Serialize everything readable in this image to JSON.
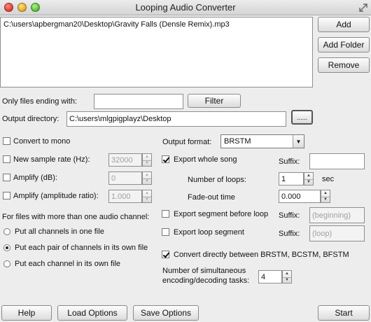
{
  "window": {
    "title": "Looping Audio Converter"
  },
  "file_list": {
    "items": [
      "C:\\users\\apbergman20\\Desktop\\Gravity Falls (Densle Remix).mp3"
    ]
  },
  "side_buttons": {
    "add": "Add",
    "add_folder": "Add Folder",
    "remove": "Remove"
  },
  "filter": {
    "label": "Only files ending with:",
    "value": "",
    "button": "Filter"
  },
  "output_dir": {
    "label": "Output directory:",
    "value": "C:\\users\\mlgpigplayz\\Desktop",
    "browse": "......"
  },
  "options": {
    "convert_mono": {
      "label": "Convert to mono",
      "checked": false
    },
    "sample_rate": {
      "label": "New sample rate (Hz):",
      "checked": false,
      "value": "32000"
    },
    "amplify_db": {
      "label": "Amplify (dB):",
      "checked": false,
      "value": "0"
    },
    "amplify_ratio": {
      "label": "Amplify (amplitude ratio):",
      "checked": false,
      "value": "1.000"
    }
  },
  "channels": {
    "heading": "For files with more than one audio channel:",
    "options": [
      "Put all channels in one file",
      "Put each pair of channels in its own file",
      "Put each channel in its own file"
    ],
    "selected_index": 1
  },
  "output_format": {
    "label": "Output format:",
    "value": "BRSTM"
  },
  "export_whole": {
    "label": "Export whole song",
    "checked": true,
    "suffix_label": "Suffix:",
    "suffix_value": ""
  },
  "loops": {
    "label": "Number of loops:",
    "value": "1",
    "unit": "sec"
  },
  "fade": {
    "label": "Fade-out time",
    "value": "0.000"
  },
  "export_before": {
    "label": "Export segment before loop",
    "checked": false,
    "suffix_label": "Suffix:",
    "suffix_value": "(beginning)"
  },
  "export_loop": {
    "label": "Export loop segment",
    "checked": false,
    "suffix_label": "Suffix:",
    "suffix_value": "(loop)"
  },
  "convert_direct": {
    "label": "Convert directly between BRSTM, BCSTM, BFSTM",
    "checked": true
  },
  "tasks": {
    "label_line1": "Number of simultaneous",
    "label_line2": "encoding/decoding tasks:",
    "value": "4"
  },
  "bottom_buttons": {
    "help": "Help",
    "load": "Load Options",
    "save": "Save Options",
    "start": "Start"
  }
}
